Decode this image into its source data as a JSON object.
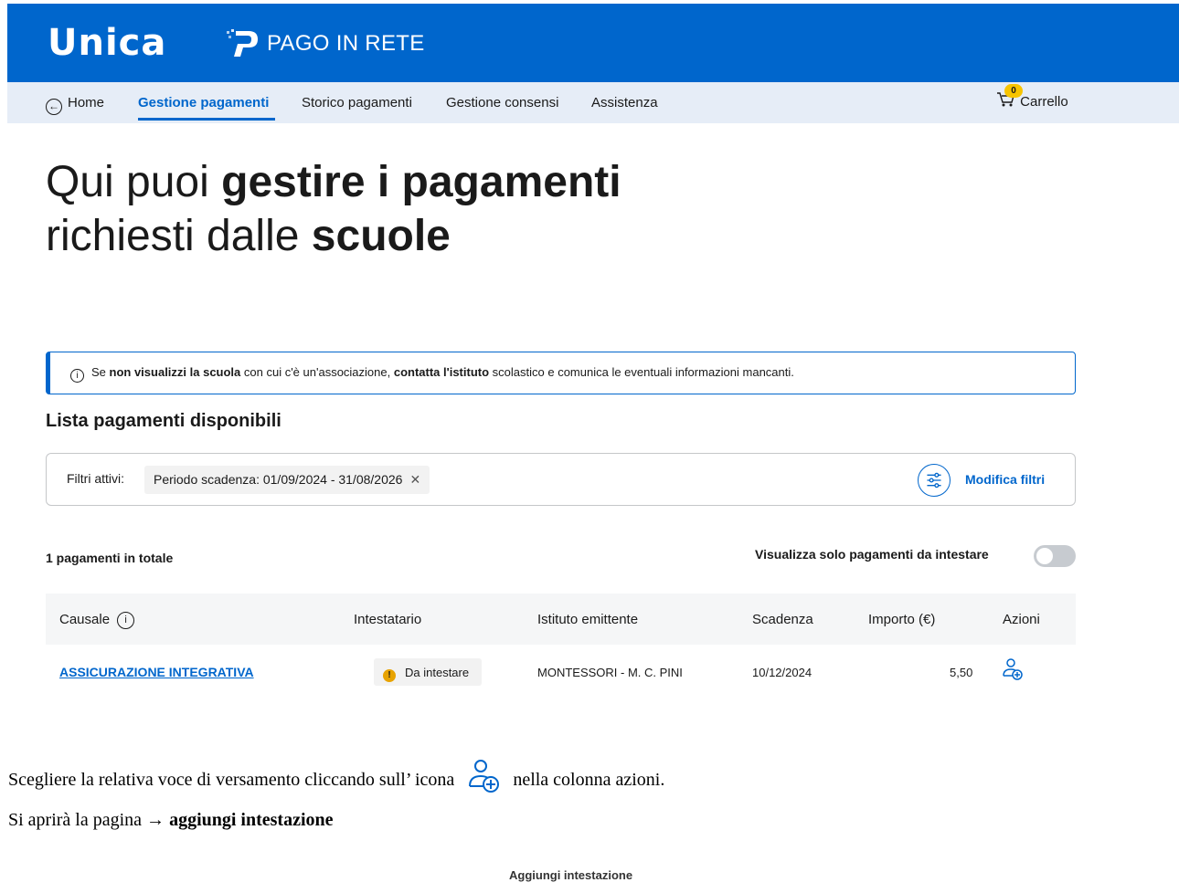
{
  "header": {
    "logo_text": "Unica",
    "service_name": "PAGO IN RETE"
  },
  "nav": {
    "home": "Home",
    "items": [
      {
        "label": "Gestione pagamenti",
        "active": true
      },
      {
        "label": "Storico pagamenti",
        "active": false
      },
      {
        "label": "Gestione consensi",
        "active": false
      },
      {
        "label": "Assistenza",
        "active": false
      }
    ],
    "cart_label": "Carrello",
    "cart_count": "0"
  },
  "hero": {
    "part1": "Qui puoi ",
    "bold1": "gestire i pagamenti",
    "part2": " richiesti dalle ",
    "bold2": "scuole"
  },
  "info": {
    "t1": "Se ",
    "b1": "non visualizzi la scuola",
    "t2": " con cui c'è un'associazione, ",
    "b2": "contatta l'istituto",
    "t3": " scolastico e comunica le eventuali informazioni mancanti."
  },
  "list": {
    "title": "Lista pagamenti disponibili",
    "filters_label": "Filtri attivi:",
    "filter_chip": "Periodo scadenza: 01/09/2024 - 31/08/2026",
    "edit_filters": "Modifica filtri",
    "total": "1 pagamenti in totale",
    "toggle_label": "Visualizza solo pagamenti da intestare",
    "toggle_on": false
  },
  "table": {
    "columns": [
      "Causale",
      "Intestatario",
      "Istituto emittente",
      "Scadenza",
      "Importo (€)",
      "Azioni"
    ],
    "rows": [
      {
        "causale": "ASSICURAZIONE INTEGRATIVA",
        "intestatario": "Da intestare",
        "istituto": "MONTESSORI - M. C. PINI",
        "scadenza": "10/12/2024",
        "importo": "5,50"
      }
    ]
  },
  "doc": {
    "line1_a": "Scegliere la relativa voce di versamento cliccando sull’ icona",
    "line1_b": "nella colonna azioni.",
    "line2_a": "Si aprirà la pagina → ",
    "line2_b": "aggiungi intestazione",
    "footer_title": "Aggiungi intestazione"
  },
  "colors": {
    "brand_blue": "#0066cc",
    "nav_bg": "#e6edf7",
    "warning": "#e8a300",
    "cart_badge": "#f7c400"
  }
}
